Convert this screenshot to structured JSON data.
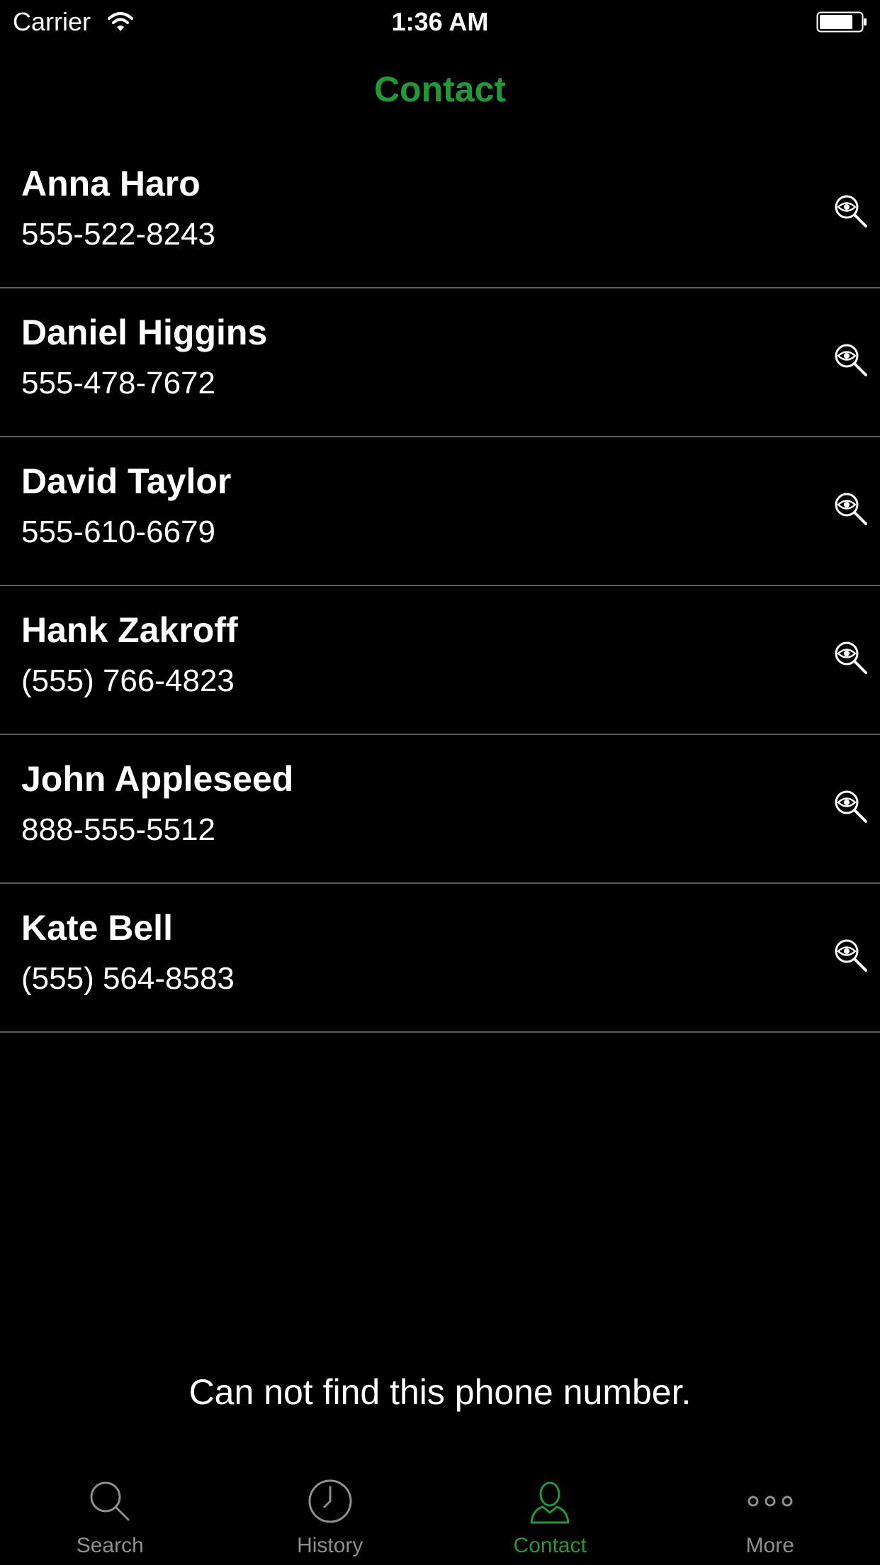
{
  "status_bar": {
    "carrier": "Carrier",
    "time": "1:36 AM"
  },
  "nav": {
    "title": "Contact"
  },
  "contacts": [
    {
      "name": "Anna Haro",
      "phone": "555-522-8243"
    },
    {
      "name": "Daniel Higgins",
      "phone": "555-478-7672"
    },
    {
      "name": "David Taylor",
      "phone": "555-610-6679"
    },
    {
      "name": "Hank Zakroff",
      "phone": "(555) 766-4823"
    },
    {
      "name": "John Appleseed",
      "phone": "888-555-5512"
    },
    {
      "name": "Kate Bell",
      "phone": "(555) 564-8583"
    }
  ],
  "message": "Can not find this phone number.",
  "tab_bar": {
    "tabs": [
      {
        "label": "Search",
        "icon": "search-icon",
        "active": false
      },
      {
        "label": "History",
        "icon": "clock-icon",
        "active": false
      },
      {
        "label": "Contact",
        "icon": "person-icon",
        "active": true
      },
      {
        "label": "More",
        "icon": "more-dots-icon",
        "active": false
      }
    ]
  },
  "colors": {
    "background": "#000000",
    "accent": "#1f9a34",
    "inactive_tab": "#8e8e8e",
    "separator": "#5a5a5a"
  }
}
